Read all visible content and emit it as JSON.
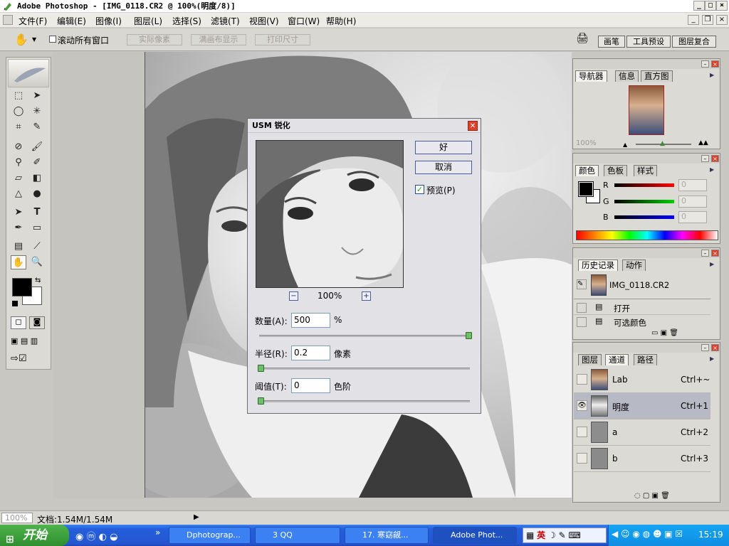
{
  "app": {
    "title": "Adobe Photoshop - [IMG_0118.CR2 @ 100%(明度/8)]"
  },
  "menu": [
    "文件(F)",
    "编辑(E)",
    "图像(I)",
    "图层(L)",
    "选择(S)",
    "滤镜(T)",
    "视图(V)",
    "窗口(W)",
    "帮助(H)"
  ],
  "options_bar": {
    "scroll_all_windows": "滚动所有窗口",
    "actual_pixels": "实际像素",
    "fit_on_screen": "满画布显示",
    "print_size": "打印尺寸",
    "palette_tabs": [
      "画笔",
      "工具预设",
      "图层复合"
    ]
  },
  "dialog": {
    "title": "USM 锐化",
    "ok": "好",
    "cancel": "取消",
    "preview_label": "预览(P)",
    "preview_checked": true,
    "zoom": "100%",
    "zoom_out": "−",
    "zoom_in": "+",
    "amount_label": "数量(A):",
    "amount_value": "500",
    "amount_unit": "%",
    "amount_slider": 1.0,
    "radius_label": "半径(R):",
    "radius_value": "0.2",
    "radius_unit": "像素",
    "radius_slider": 0.0,
    "threshold_label": "阈值(T):",
    "threshold_value": "0",
    "threshold_unit": "色阶",
    "threshold_slider": 0.0
  },
  "navigator": {
    "tabs": [
      "导航器",
      "信息",
      "直方图"
    ],
    "zoom": "100%"
  },
  "color": {
    "tabs": [
      "颜色",
      "色板",
      "样式"
    ],
    "r_label": "R",
    "g_label": "G",
    "b_label": "B",
    "r_value": "0",
    "g_value": "0",
    "b_value": "0"
  },
  "history": {
    "tabs": [
      "历史记录",
      "动作"
    ],
    "snapshot": "IMG_0118.CR2",
    "steps": [
      "打开",
      "可选颜色"
    ]
  },
  "channels": {
    "tabs": [
      "图层",
      "通道",
      "路径"
    ],
    "rows": [
      {
        "name": "Lab",
        "shortcut": "Ctrl+~"
      },
      {
        "name": "明度",
        "shortcut": "Ctrl+1"
      },
      {
        "name": "a",
        "shortcut": "Ctrl+2"
      },
      {
        "name": "b",
        "shortcut": "Ctrl+3"
      }
    ]
  },
  "status": {
    "zoom": "100%",
    "doc": "文档:1.54M/1.54M"
  },
  "taskbar": {
    "start": "开始",
    "buttons": [
      "Dphotograp...",
      "3 QQ",
      "17. 寒窈觎...",
      "Adobe Phot..."
    ],
    "ime": "英",
    "clock": "15:19"
  }
}
